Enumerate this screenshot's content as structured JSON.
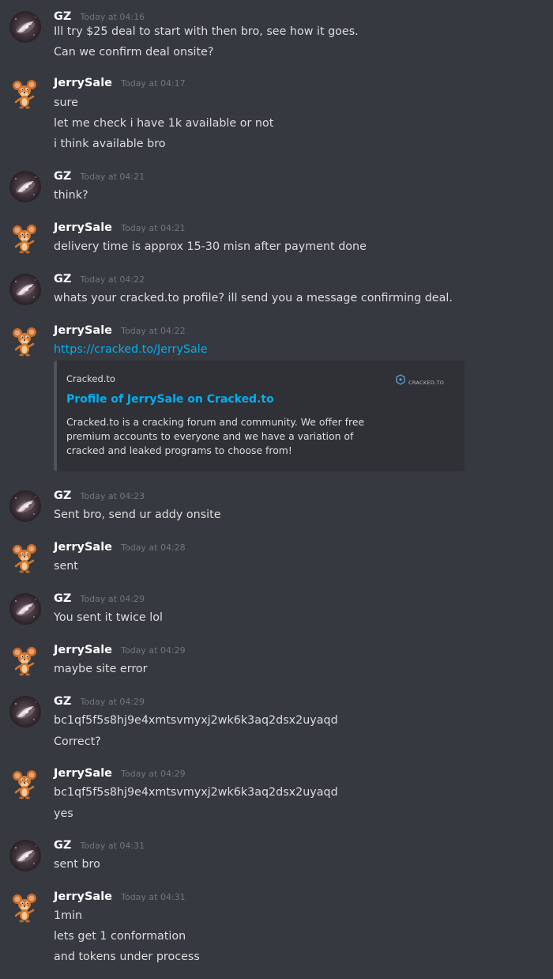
{
  "users": {
    "gz": {
      "name": "GZ",
      "avatar_icon": "galaxy-avatar-icon"
    },
    "jerry": {
      "name": "JerrySale",
      "avatar_icon": "jerry-mouse-avatar-icon"
    }
  },
  "colors": {
    "background": "#36393f",
    "text": "#dcddde",
    "username": "#ffffff",
    "timestamp": "#72767d",
    "link": "#00b0f4",
    "embed_background": "#2f3136",
    "embed_border": "#4f545c"
  },
  "messages": [
    {
      "author": "GZ",
      "time": "Today at 04:16",
      "lines": [
        "Ill try $25 deal to start with then bro, see how it goes.",
        "Can we confirm deal onsite?"
      ]
    },
    {
      "author": "JerrySale",
      "time": "Today at 04:17",
      "lines": [
        "sure",
        "let me check i have 1k available or not",
        "i think available bro"
      ]
    },
    {
      "author": "GZ",
      "time": "Today at 04:21",
      "lines": [
        "think?"
      ]
    },
    {
      "author": "JerrySale",
      "time": "Today at 04:21",
      "lines": [
        "delivery time is approx 15-30 misn after payment done"
      ]
    },
    {
      "author": "GZ",
      "time": "Today at 04:22",
      "lines": [
        "whats your cracked.to profile? ill send you a message confirming deal."
      ]
    },
    {
      "author": "JerrySale",
      "time": "Today at 04:22",
      "link": "https://cracked.to/JerrySale",
      "embed": {
        "provider": "Cracked.to",
        "title": "Profile of JerrySale on Cracked.to",
        "description": "Cracked.to is a cracking forum and community. We offer free premium accounts to everyone and we have a variation of cracked and leaked programs to choose from!",
        "thumbnail_text": "CRACKED.TO",
        "thumbnail_icon": "cracked-to-logo-icon"
      }
    },
    {
      "author": "GZ",
      "time": "Today at 04:23",
      "lines": [
        "Sent bro, send ur addy onsite"
      ]
    },
    {
      "author": "JerrySale",
      "time": "Today at 04:28",
      "lines": [
        "sent"
      ]
    },
    {
      "author": "GZ",
      "time": "Today at 04:29",
      "lines": [
        "You sent it twice lol"
      ]
    },
    {
      "author": "JerrySale",
      "time": "Today at 04:29",
      "lines": [
        "maybe site error"
      ]
    },
    {
      "author": "GZ",
      "time": "Today at 04:29",
      "lines": [
        "bc1qf5f5s8hj9e4xmtsvmyxj2wk6k3aq2dsx2uyaqd",
        "Correct?"
      ]
    },
    {
      "author": "JerrySale",
      "time": "Today at 04:29",
      "lines": [
        "bc1qf5f5s8hj9e4xmtsvmyxj2wk6k3aq2dsx2uyaqd",
        "yes"
      ]
    },
    {
      "author": "GZ",
      "time": "Today at 04:31",
      "lines": [
        "sent bro"
      ]
    },
    {
      "author": "JerrySale",
      "time": "Today at 04:31",
      "lines": [
        "1min",
        "lets get 1 conformation",
        "and tokens under process"
      ]
    }
  ]
}
